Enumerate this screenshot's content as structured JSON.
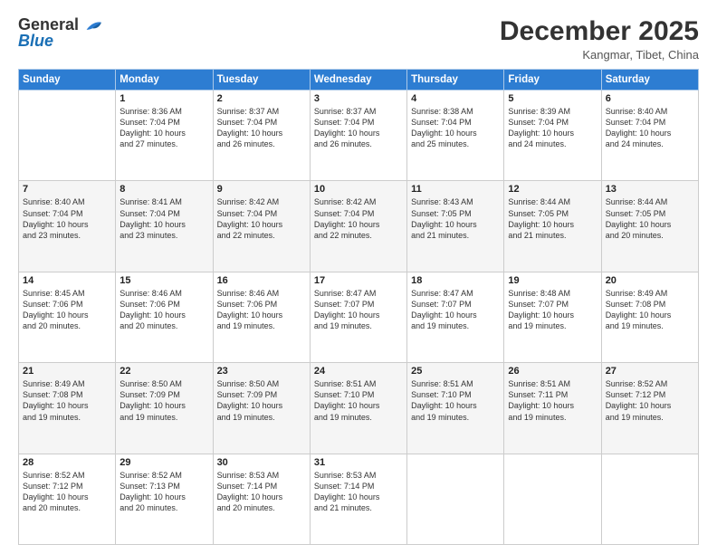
{
  "logo": {
    "general": "General",
    "blue": "Blue"
  },
  "title": "December 2025",
  "location": "Kangmar, Tibet, China",
  "days_of_week": [
    "Sunday",
    "Monday",
    "Tuesday",
    "Wednesday",
    "Thursday",
    "Friday",
    "Saturday"
  ],
  "weeks": [
    [
      {
        "day": "",
        "info": ""
      },
      {
        "day": "1",
        "info": "Sunrise: 8:36 AM\nSunset: 7:04 PM\nDaylight: 10 hours\nand 27 minutes."
      },
      {
        "day": "2",
        "info": "Sunrise: 8:37 AM\nSunset: 7:04 PM\nDaylight: 10 hours\nand 26 minutes."
      },
      {
        "day": "3",
        "info": "Sunrise: 8:37 AM\nSunset: 7:04 PM\nDaylight: 10 hours\nand 26 minutes."
      },
      {
        "day": "4",
        "info": "Sunrise: 8:38 AM\nSunset: 7:04 PM\nDaylight: 10 hours\nand 25 minutes."
      },
      {
        "day": "5",
        "info": "Sunrise: 8:39 AM\nSunset: 7:04 PM\nDaylight: 10 hours\nand 24 minutes."
      },
      {
        "day": "6",
        "info": "Sunrise: 8:40 AM\nSunset: 7:04 PM\nDaylight: 10 hours\nand 24 minutes."
      }
    ],
    [
      {
        "day": "7",
        "info": "Sunrise: 8:40 AM\nSunset: 7:04 PM\nDaylight: 10 hours\nand 23 minutes."
      },
      {
        "day": "8",
        "info": "Sunrise: 8:41 AM\nSunset: 7:04 PM\nDaylight: 10 hours\nand 23 minutes."
      },
      {
        "day": "9",
        "info": "Sunrise: 8:42 AM\nSunset: 7:04 PM\nDaylight: 10 hours\nand 22 minutes."
      },
      {
        "day": "10",
        "info": "Sunrise: 8:42 AM\nSunset: 7:04 PM\nDaylight: 10 hours\nand 22 minutes."
      },
      {
        "day": "11",
        "info": "Sunrise: 8:43 AM\nSunset: 7:05 PM\nDaylight: 10 hours\nand 21 minutes."
      },
      {
        "day": "12",
        "info": "Sunrise: 8:44 AM\nSunset: 7:05 PM\nDaylight: 10 hours\nand 21 minutes."
      },
      {
        "day": "13",
        "info": "Sunrise: 8:44 AM\nSunset: 7:05 PM\nDaylight: 10 hours\nand 20 minutes."
      }
    ],
    [
      {
        "day": "14",
        "info": "Sunrise: 8:45 AM\nSunset: 7:06 PM\nDaylight: 10 hours\nand 20 minutes."
      },
      {
        "day": "15",
        "info": "Sunrise: 8:46 AM\nSunset: 7:06 PM\nDaylight: 10 hours\nand 20 minutes."
      },
      {
        "day": "16",
        "info": "Sunrise: 8:46 AM\nSunset: 7:06 PM\nDaylight: 10 hours\nand 19 minutes."
      },
      {
        "day": "17",
        "info": "Sunrise: 8:47 AM\nSunset: 7:07 PM\nDaylight: 10 hours\nand 19 minutes."
      },
      {
        "day": "18",
        "info": "Sunrise: 8:47 AM\nSunset: 7:07 PM\nDaylight: 10 hours\nand 19 minutes."
      },
      {
        "day": "19",
        "info": "Sunrise: 8:48 AM\nSunset: 7:07 PM\nDaylight: 10 hours\nand 19 minutes."
      },
      {
        "day": "20",
        "info": "Sunrise: 8:49 AM\nSunset: 7:08 PM\nDaylight: 10 hours\nand 19 minutes."
      }
    ],
    [
      {
        "day": "21",
        "info": "Sunrise: 8:49 AM\nSunset: 7:08 PM\nDaylight: 10 hours\nand 19 minutes."
      },
      {
        "day": "22",
        "info": "Sunrise: 8:50 AM\nSunset: 7:09 PM\nDaylight: 10 hours\nand 19 minutes."
      },
      {
        "day": "23",
        "info": "Sunrise: 8:50 AM\nSunset: 7:09 PM\nDaylight: 10 hours\nand 19 minutes."
      },
      {
        "day": "24",
        "info": "Sunrise: 8:51 AM\nSunset: 7:10 PM\nDaylight: 10 hours\nand 19 minutes."
      },
      {
        "day": "25",
        "info": "Sunrise: 8:51 AM\nSunset: 7:10 PM\nDaylight: 10 hours\nand 19 minutes."
      },
      {
        "day": "26",
        "info": "Sunrise: 8:51 AM\nSunset: 7:11 PM\nDaylight: 10 hours\nand 19 minutes."
      },
      {
        "day": "27",
        "info": "Sunrise: 8:52 AM\nSunset: 7:12 PM\nDaylight: 10 hours\nand 19 minutes."
      }
    ],
    [
      {
        "day": "28",
        "info": "Sunrise: 8:52 AM\nSunset: 7:12 PM\nDaylight: 10 hours\nand 20 minutes."
      },
      {
        "day": "29",
        "info": "Sunrise: 8:52 AM\nSunset: 7:13 PM\nDaylight: 10 hours\nand 20 minutes."
      },
      {
        "day": "30",
        "info": "Sunrise: 8:53 AM\nSunset: 7:14 PM\nDaylight: 10 hours\nand 20 minutes."
      },
      {
        "day": "31",
        "info": "Sunrise: 8:53 AM\nSunset: 7:14 PM\nDaylight: 10 hours\nand 21 minutes."
      },
      {
        "day": "",
        "info": ""
      },
      {
        "day": "",
        "info": ""
      },
      {
        "day": "",
        "info": ""
      }
    ]
  ],
  "colors": {
    "header_bg": "#2d7dd2",
    "header_text": "#ffffff",
    "border": "#cccccc"
  }
}
